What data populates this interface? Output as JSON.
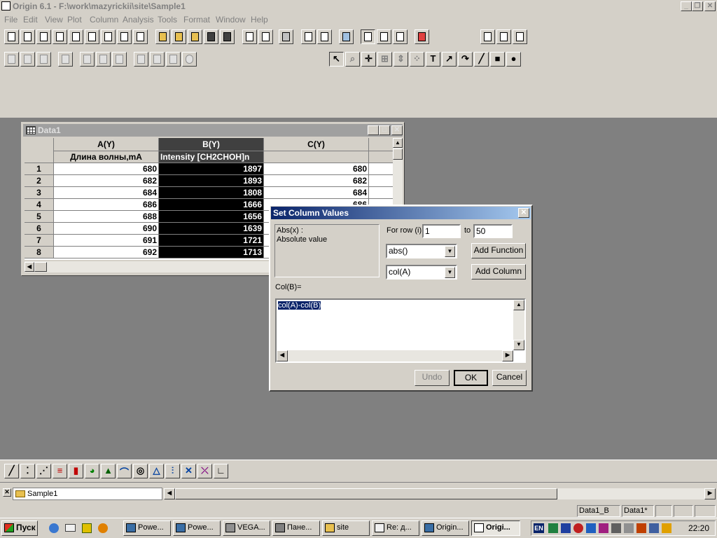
{
  "app": {
    "title": "Origin 6.1 - F:\\work\\mazyrickii\\site\\Sample1",
    "menu": [
      "File",
      "Edit",
      "View",
      "Plot",
      "Column",
      "Analysis",
      "Tools",
      "Format",
      "Window",
      "Help"
    ]
  },
  "toolbar2": {
    "text_tool": "T"
  },
  "datawin": {
    "title": "Data1",
    "columns": [
      {
        "name": "A(Y)",
        "label": "Длина волны,mA"
      },
      {
        "name": "B(Y)",
        "label": "Intensity [CH2CHOH]n"
      },
      {
        "name": "C(Y)",
        "label": ""
      }
    ],
    "rows": [
      {
        "n": "1",
        "a": "680",
        "b": "1897",
        "c": "680"
      },
      {
        "n": "2",
        "a": "682",
        "b": "1893",
        "c": "682"
      },
      {
        "n": "3",
        "a": "684",
        "b": "1808",
        "c": "684"
      },
      {
        "n": "4",
        "a": "686",
        "b": "1666",
        "c": "686"
      },
      {
        "n": "5",
        "a": "688",
        "b": "1656",
        "c": ""
      },
      {
        "n": "6",
        "a": "690",
        "b": "1639",
        "c": ""
      },
      {
        "n": "7",
        "a": "691",
        "b": "1721",
        "c": ""
      },
      {
        "n": "8",
        "a": "692",
        "b": "1713",
        "c": ""
      }
    ]
  },
  "dialog": {
    "title": "Set Column Values",
    "desc_line1": "Abs(x) :",
    "desc_line2": "Absolute value",
    "for_row_label": "For row (i)",
    "from": "1",
    "to_label": "to",
    "to": "50",
    "function_combo": "abs()",
    "column_combo": "col(A)",
    "add_function": "Add Function",
    "add_column": "Add Column",
    "expr_label": "Col(B)=",
    "expression": "col(A)-col(B)",
    "undo": "Undo",
    "ok": "OK",
    "cancel": "Cancel"
  },
  "project": {
    "folder": "Sample1"
  },
  "status": {
    "cell1": "Data1_B",
    "cell2": "Data1*"
  },
  "taskbar": {
    "start": "Пуск",
    "tasks": [
      "Powe...",
      "Powe...",
      "VEGA...",
      "Пане...",
      "site",
      "Re: д...",
      "Origin...",
      "Origi..."
    ],
    "clock": "22:20",
    "lang": "EN"
  },
  "colors": {
    "dialog_caption": "#0a246a",
    "selected_column": "#000000",
    "desktop": "#808080"
  }
}
